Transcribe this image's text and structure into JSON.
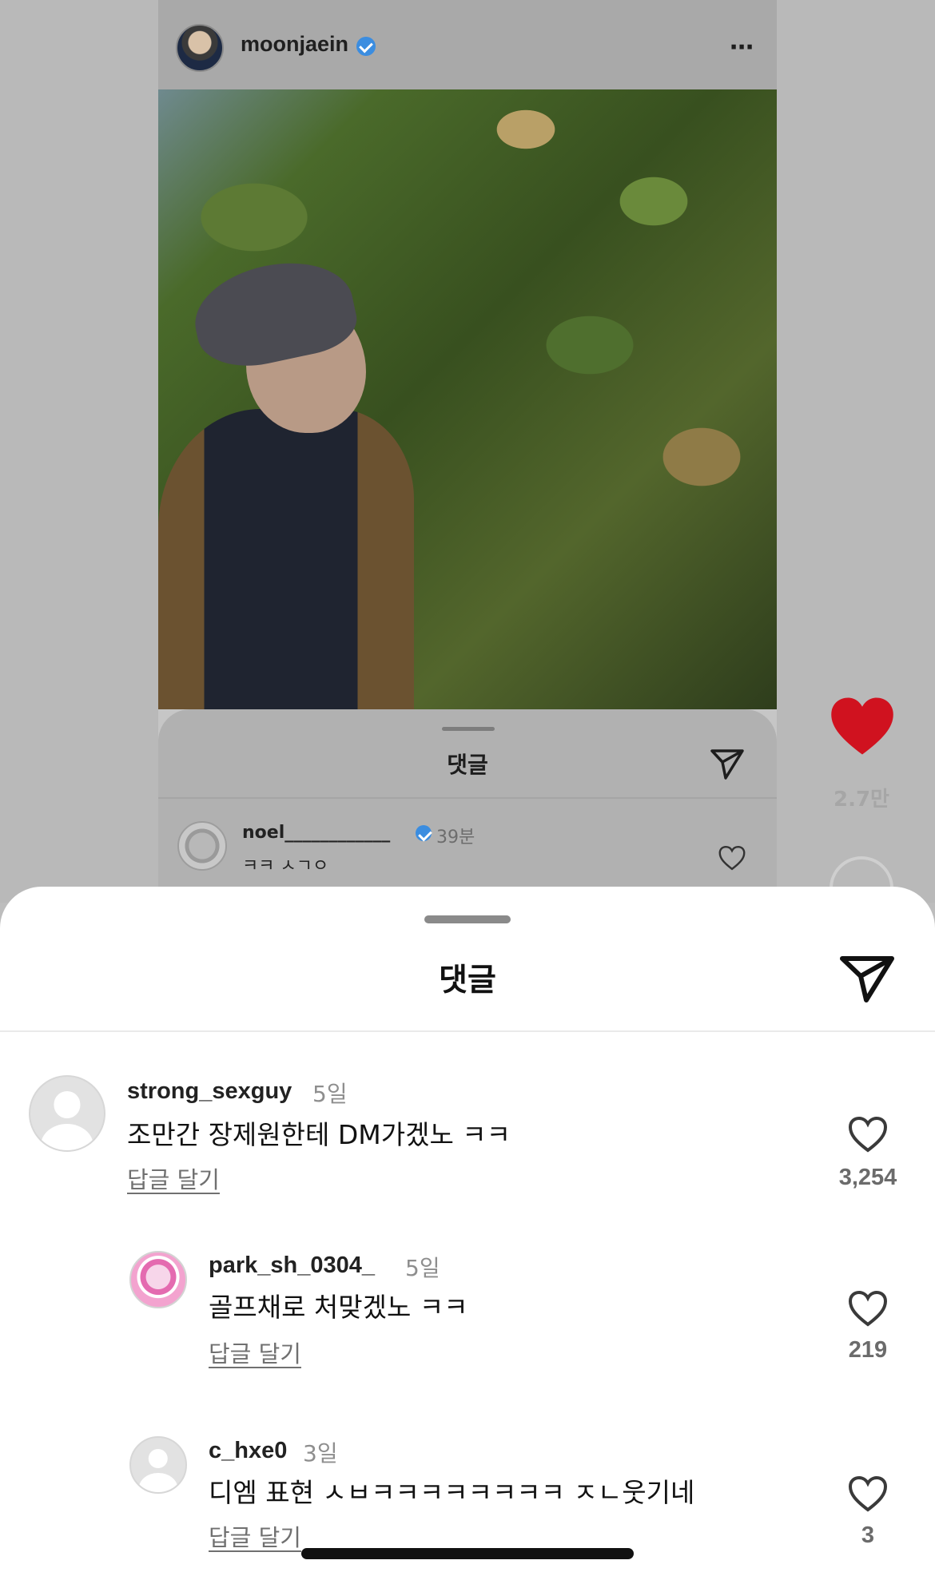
{
  "post": {
    "username": "moonjaein",
    "more_label": "⋯",
    "sheet_title": "댓글",
    "preview_comment": {
      "username": "noel____________",
      "time": "39분",
      "text": "ㅋㅋ ㅅㄱㅇ"
    },
    "side_like_count": "2.7만"
  },
  "sheet": {
    "title": "댓글"
  },
  "comments": [
    {
      "username": "strong_sexguy",
      "time": "5일",
      "text": "조만간 장제원한테 DM가겠노 ㅋㅋ",
      "reply_label": "답글 달기",
      "likes": "3,254",
      "avatar": "default-avatar-icon"
    },
    {
      "username": "park_sh_0304_",
      "time": "5일",
      "text": "골프채로 처맞겠노 ㅋㅋ",
      "reply_label": "답글 달기",
      "likes": "219",
      "avatar": "pink-character-avatar"
    },
    {
      "username": "c_hxe0",
      "time": "3일",
      "text": "디엠 표현 ㅅㅂㅋㅋㅋㅋㅋㅋㅋㅋ ㅈㄴ웃기네",
      "reply_label": "답글 달기",
      "likes": "3",
      "avatar": "default-avatar-icon"
    }
  ],
  "colors": {
    "like_red": "#d0121f",
    "sheet_bg": "#ffffff",
    "dim_bg": "#bdbdbd",
    "verified_blue": "#3b8de0"
  }
}
